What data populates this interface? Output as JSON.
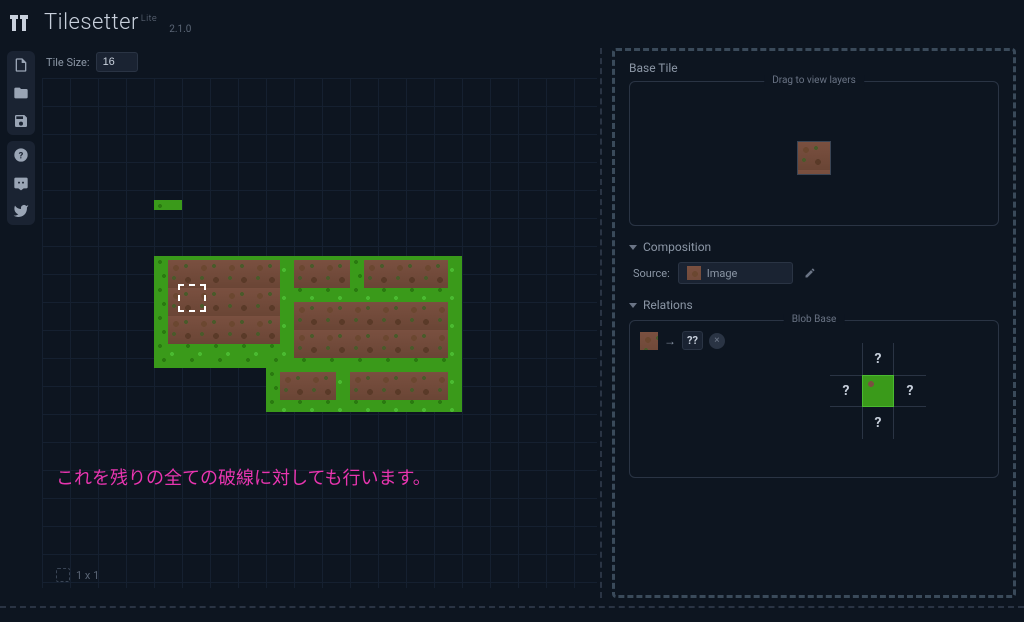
{
  "header": {
    "app_name": "Tilesetter",
    "edition": "Lite",
    "version": "2.1.0"
  },
  "toolbar": {
    "tile_size_label": "Tile Size:",
    "tile_size_value": "16"
  },
  "canvas": {
    "coord_text": "1 x 1",
    "annotation": "これを残りの全ての破線に対しても行います。"
  },
  "panel": {
    "base_tile_title": "Base Tile",
    "drag_label": "Drag to view layers",
    "composition_title": "Composition",
    "source_label": "Source:",
    "source_value": "Image",
    "relations_title": "Relations",
    "blob_label": "Blob Base",
    "question_pair": "??",
    "q": "?"
  },
  "icons": {
    "file": "file-icon",
    "open": "folder-icon",
    "save": "save-icon",
    "help": "help-icon",
    "discord": "discord-icon",
    "twitter": "twitter-icon"
  }
}
